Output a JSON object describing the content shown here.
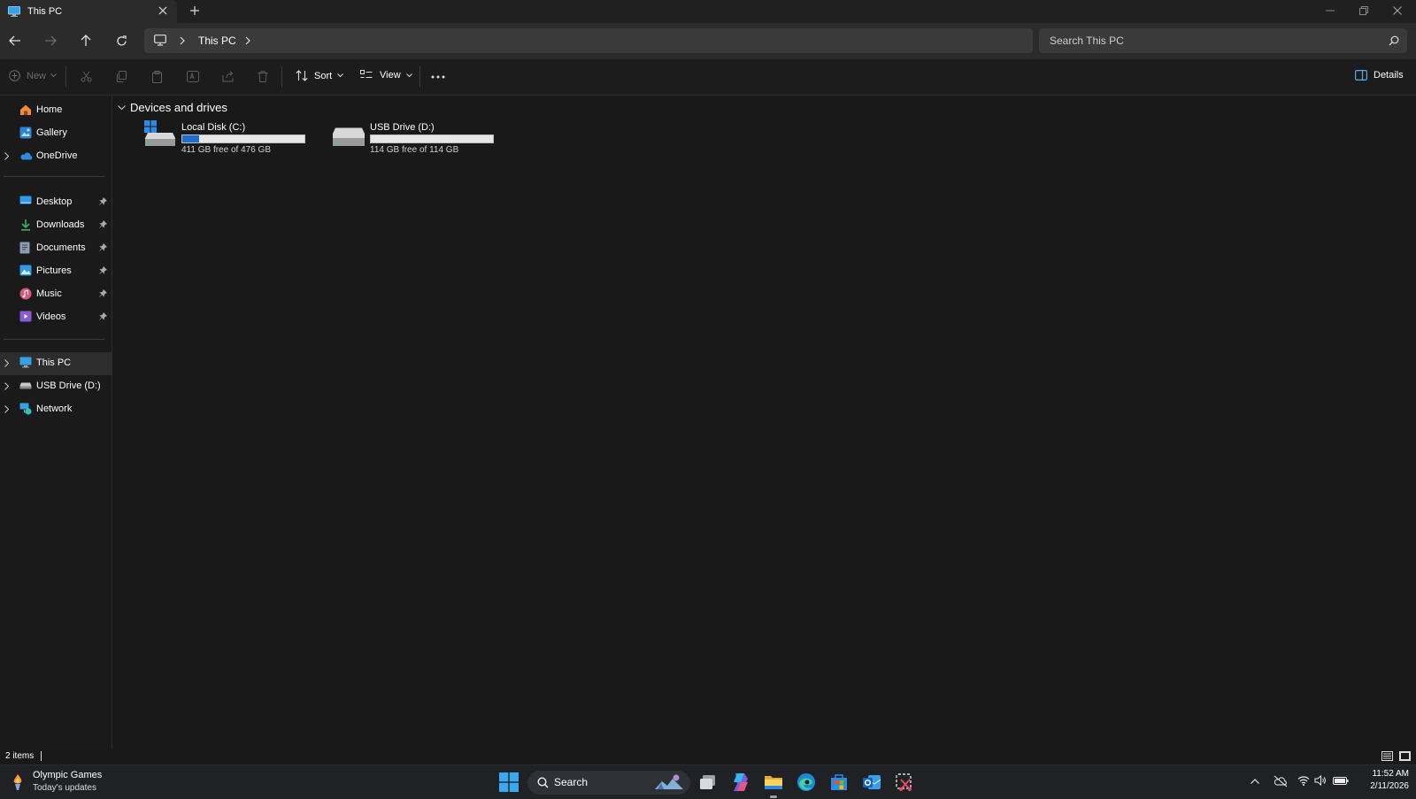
{
  "window": {
    "tab_title": "This PC",
    "new_tab": "+"
  },
  "nav": {
    "breadcrumb": [
      "This PC"
    ],
    "search_placeholder": "Search This PC"
  },
  "commands": {
    "new": "New",
    "sort": "Sort",
    "view": "View",
    "details": "Details"
  },
  "sidebar": {
    "top": [
      {
        "label": "Home",
        "icon": "home-icon"
      },
      {
        "label": "Gallery",
        "icon": "gallery-icon"
      },
      {
        "label": "OneDrive",
        "icon": "onedrive-icon",
        "expandable": true
      }
    ],
    "quick_access": [
      {
        "label": "Desktop",
        "icon": "desktop-icon",
        "pinned": true
      },
      {
        "label": "Downloads",
        "icon": "downloads-icon",
        "pinned": true
      },
      {
        "label": "Documents",
        "icon": "documents-icon",
        "pinned": true
      },
      {
        "label": "Pictures",
        "icon": "pictures-icon",
        "pinned": true
      },
      {
        "label": "Music",
        "icon": "music-icon",
        "pinned": true
      },
      {
        "label": "Videos",
        "icon": "videos-icon",
        "pinned": true
      }
    ],
    "locations": [
      {
        "label": "This PC",
        "icon": "this-pc-icon",
        "selected": true
      },
      {
        "label": "USB Drive (D:)",
        "icon": "usb-drive-icon"
      },
      {
        "label": "Network",
        "icon": "network-icon"
      }
    ]
  },
  "content": {
    "group_title": "Devices and drives",
    "drives": [
      {
        "name": "Local Disk (C:)",
        "free_text": "411 GB free of 476 GB",
        "used_fraction": 0.137,
        "icon": "windows-drive-icon"
      },
      {
        "name": "USB Drive (D:)",
        "free_text": "114 GB free of 114 GB",
        "used_fraction": 0.0,
        "icon": "usb-drive-icon"
      }
    ]
  },
  "status": {
    "item_count": "2 items"
  },
  "taskbar": {
    "widget_title": "Olympic Games",
    "widget_subtitle": "Today's updates",
    "search_label": "Search",
    "time": "11:52 AM",
    "date": "2/11/2026"
  },
  "colors": {
    "accent": "#1b6fd1",
    "background": "#191919",
    "titlebar": "#202020",
    "navbar": "#2b2b2b"
  }
}
